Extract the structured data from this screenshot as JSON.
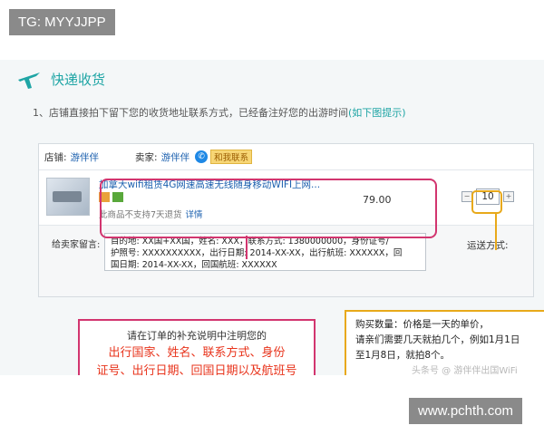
{
  "tg_label": "TG: MYYJJPP",
  "section": {
    "title": "快递收货",
    "icon": "airplane-icon"
  },
  "instruction": {
    "prefix": "1、店铺直接拍下留下您的收货地址联系方式，已经备注好您的出游时间",
    "link": "(如下图提示)"
  },
  "store_row": {
    "store_label": "店铺:",
    "store_value": "游伴伴",
    "seller_label": "卖家:",
    "seller_value": "游伴伴",
    "contact_label": "和我联系"
  },
  "product": {
    "name": "加拿大wifi租赁4G网速高速无线随身移动WIFI上网...",
    "note": "此商品不支持7天退货",
    "detail_link": "详情",
    "price": "79.00",
    "quantity": "10"
  },
  "message": {
    "label": "给卖家留言:",
    "lines": [
      "目的地: XX国+XX国，姓名: XXX，联系方式: 1380000000，身份证号/",
      "护照号: XXXXXXXXXX，出行日期: 2014-XX-XX，出行航班: XXXXXX，回",
      "国日期: 2014-XX-XX，回国航班: XXXXXX"
    ],
    "shipping_label": "运送方式:"
  },
  "callout_red": {
    "head": "请在订单的补充说明中注明您的",
    "lines": [
      "出行国家、姓名、联系方式、身份",
      "证号、出行日期、回国日期以及航班号"
    ]
  },
  "callout_orange": {
    "lines": [
      "购买数量：价格是一天的单价，",
      "请亲们需要几天就拍几个，例如1月1日",
      "至1月8日，就拍8个。"
    ]
  },
  "faint_watermark": "头条号 @ 游伴伴出国WiFi",
  "footer_watermark": "www.pchth.com",
  "colors": {
    "accent": "#1fa5a5",
    "link": "#1a5fae",
    "red": "#d2356f",
    "orange": "#e8a91a",
    "alert_text": "#e8341c"
  }
}
